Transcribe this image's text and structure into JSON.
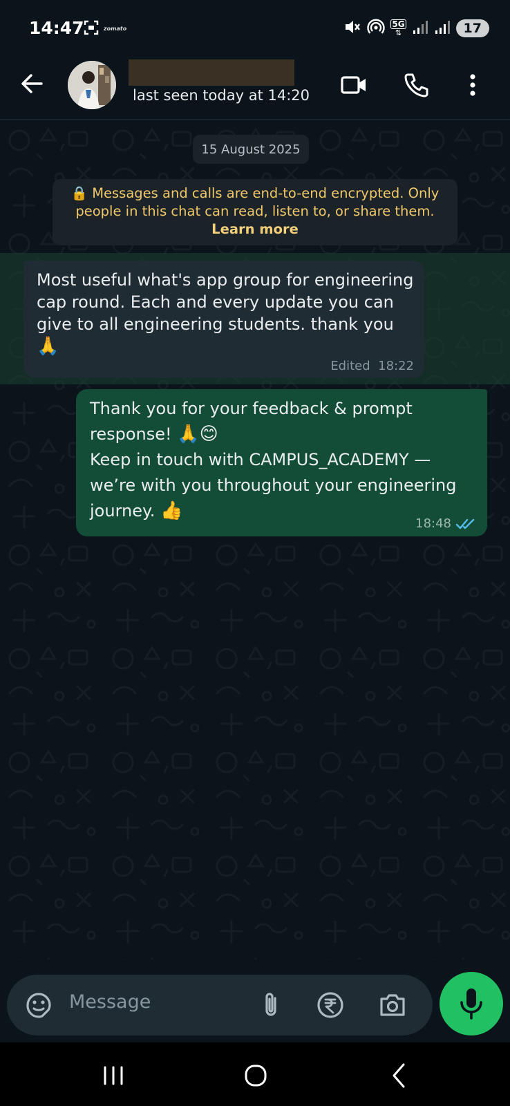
{
  "status_bar": {
    "time": "14:47",
    "app_label": "zomato",
    "network": "5G",
    "battery": "17"
  },
  "header": {
    "last_seen": "last seen today at 14:20"
  },
  "chat": {
    "date_chip": "15 August 2025",
    "encryption_notice": {
      "line1": "🔒 Messages and calls are end-to-end encrypted. Only",
      "line2": "people in this chat can read, listen to, or share them.",
      "learn_more": "Learn more"
    },
    "messages": [
      {
        "direction": "incoming",
        "text": "Most useful what's app group for engineering cap round. Each and every update you can give to all engineering students.  thank you",
        "emoji": "🙏",
        "edited_label": "Edited",
        "time": "18:22"
      },
      {
        "direction": "outgoing",
        "line1": "Thank you for your feedback & prompt",
        "line2": "response!",
        "line2_emoji": "🙏😊",
        "line3": "Keep in touch with CAMPUS_ACADEMY —",
        "line4": "we’re with you throughout your engineering",
        "line5": "journey.",
        "line5_emoji": "👍",
        "time": "18:48",
        "status": "read"
      }
    ]
  },
  "composer": {
    "placeholder": "Message"
  },
  "colors": {
    "background": "#0b141a",
    "outgoing_bubble": "#144d37",
    "incoming_bubble": "#202c33",
    "accent": "#21c063",
    "read_ticks": "#53bdeb"
  }
}
